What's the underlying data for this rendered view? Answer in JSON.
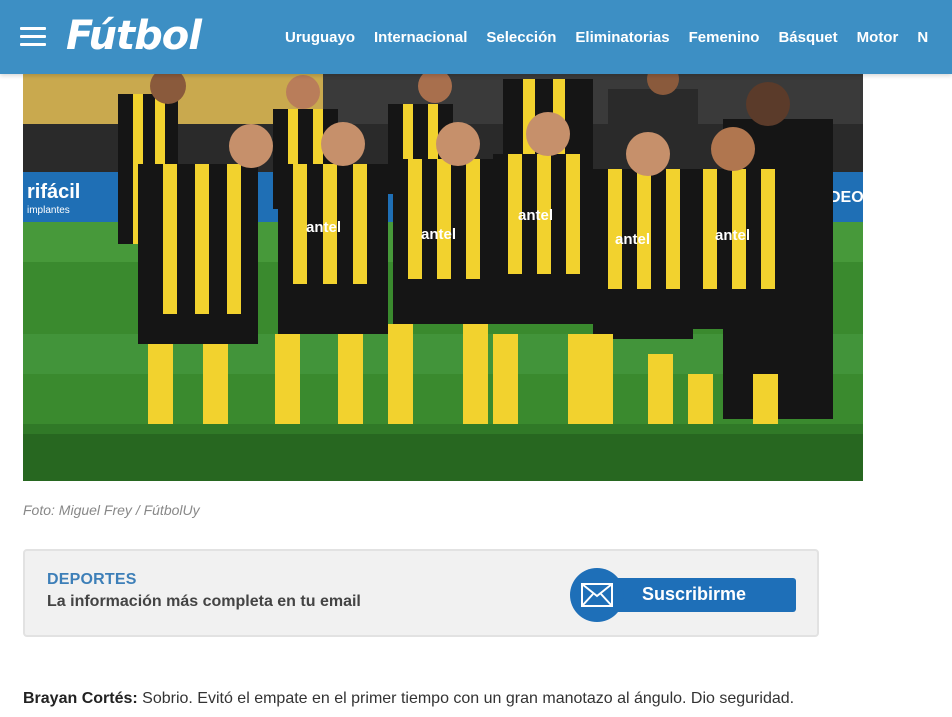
{
  "header": {
    "logo": "Fútbol",
    "nav": [
      "Uruguayo",
      "Internacional",
      "Selección",
      "Eliminatorias",
      "Femenino",
      "Básquet",
      "Motor",
      "N"
    ]
  },
  "photo": {
    "caption": "Foto: Miguel Frey / FútbolUy",
    "sponsor_text": "antel"
  },
  "newsletter": {
    "title": "DEPORTES",
    "description": "La información más completa en tu email",
    "button_label": "Suscribirme"
  },
  "article": {
    "player_name": "Brayan Cortés:",
    "text": " Sobrio. Evitó el empate en el primer tiempo con un gran manotazo al ángulo. Dio seguridad."
  },
  "colors": {
    "header_bg": "#3d8fc4",
    "accent_blue": "#1e6fb8",
    "kit_yellow": "#f2d22e",
    "kit_black": "#151515"
  }
}
